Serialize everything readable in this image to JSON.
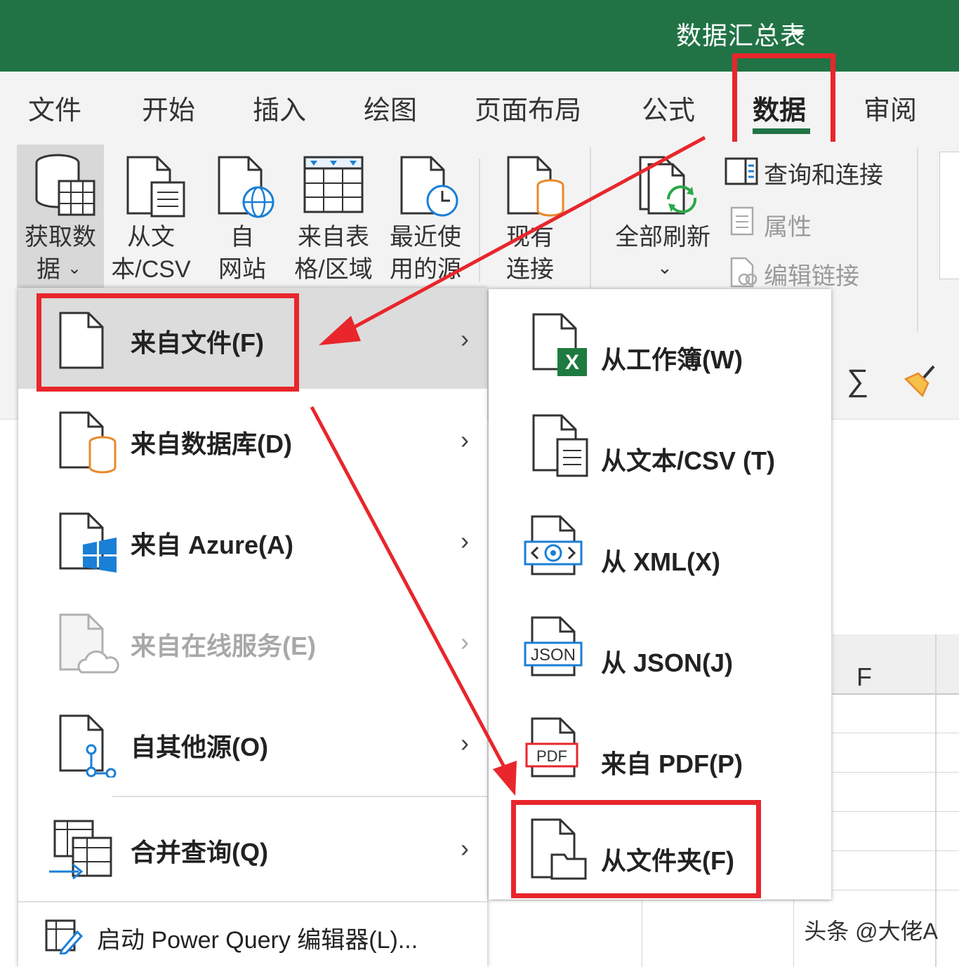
{
  "title_bar": {
    "workbook_name": "数据汇总表"
  },
  "tabs": [
    "文件",
    "开始",
    "插入",
    "绘图",
    "页面布局",
    "公式",
    "数据",
    "审阅"
  ],
  "active_tab": "数据",
  "ribbon": {
    "get_data": {
      "line1": "获取数",
      "line2": "据"
    },
    "from_text": {
      "line1": "从文",
      "line2": "本/CSV"
    },
    "from_web": {
      "line1": "自",
      "line2": "网站"
    },
    "from_table": {
      "line1": "来自表",
      "line2": "格/区域"
    },
    "recent_sources": {
      "line1": "最近使",
      "line2": "用的源"
    },
    "existing_connections": {
      "line1": "现有",
      "line2": "连接"
    },
    "refresh_all": {
      "line1": "全部刷新"
    },
    "queries_connections": "查询和连接",
    "properties": "属性",
    "edit_links": "编辑链接"
  },
  "menu": {
    "items": [
      {
        "label": "来自文件(F)",
        "arrow": "›"
      },
      {
        "label": "来自数据库(D)",
        "arrow": "›"
      },
      {
        "label": "来自 Azure(A)",
        "arrow": "›"
      },
      {
        "label": "来自在线服务(E)",
        "arrow": "›"
      },
      {
        "label": "自其他源(O)",
        "arrow": "›"
      },
      {
        "label": "合并查询(Q)",
        "arrow": "›"
      }
    ],
    "launch_power_query": "启动 Power Query 编辑器(L)..."
  },
  "submenu": {
    "items": [
      {
        "label": "从工作簿(W)"
      },
      {
        "label": "从文本/CSV (T)"
      },
      {
        "label": "从 XML(X)"
      },
      {
        "label": "从 JSON(J)"
      },
      {
        "label": "来自 PDF(P)"
      },
      {
        "label": "从文件夹(F)"
      }
    ],
    "icon_text": {
      "excel": "X",
      "json": "JSON",
      "pdf": "PDF"
    }
  },
  "sheet": {
    "column_f": "F"
  },
  "toolbar_right": {
    "sigma": "∑"
  },
  "watermark": "头条 @大佬A",
  "colors": {
    "excel_green": "#217346",
    "highlight_red": "#e8262b",
    "orange": "#e8892b",
    "blue": "#1a7fd6"
  }
}
